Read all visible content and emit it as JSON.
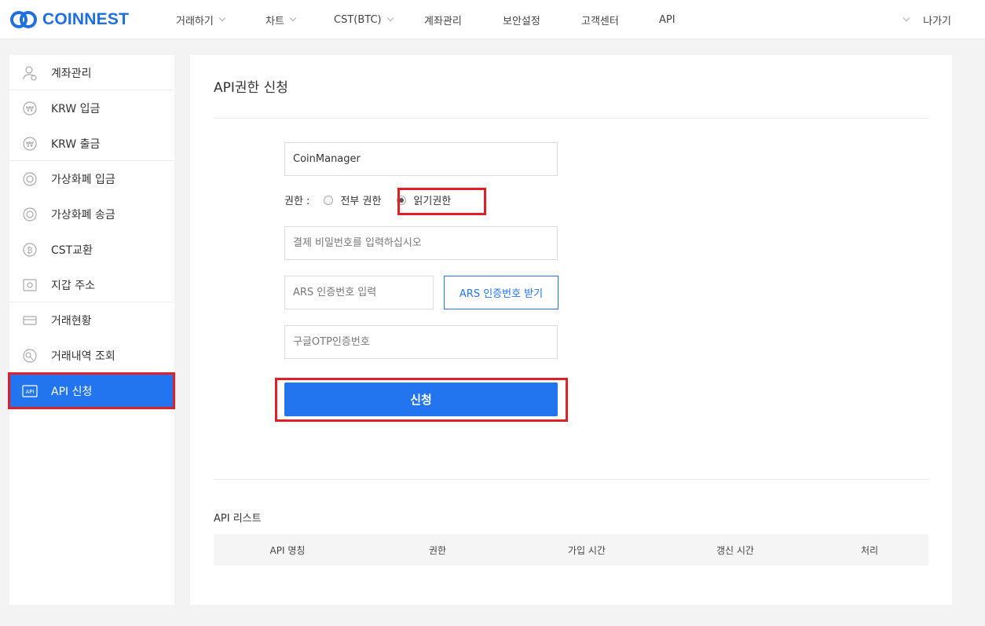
{
  "brand": {
    "name": "COINNEST",
    "color": "#1f6fe0"
  },
  "header": {
    "nav": [
      {
        "label": "거래하기",
        "dropdown": true
      },
      {
        "label": "차트",
        "dropdown": true
      },
      {
        "label": "CST(BTC)",
        "dropdown": true
      },
      {
        "label": "계좌관리",
        "dropdown": false
      },
      {
        "label": "보안설정",
        "dropdown": false
      },
      {
        "label": "고객센터",
        "dropdown": false
      },
      {
        "label": "API",
        "dropdown": false
      }
    ],
    "logout_label": "나가기"
  },
  "sidebar": {
    "items": [
      {
        "label": "계좌관리",
        "icon": "user-icon"
      },
      {
        "label": "KRW 입금",
        "icon": "won-coin-icon"
      },
      {
        "label": "KRW 출금",
        "icon": "won-coin-icon"
      },
      {
        "label": "가상화폐 입금",
        "icon": "coin-icon"
      },
      {
        "label": "가상화폐 송금",
        "icon": "coin-icon"
      },
      {
        "label": "CST교환",
        "icon": "bitcoin-icon"
      },
      {
        "label": "지갑 주소",
        "icon": "wallet-icon"
      },
      {
        "label": "거래현황",
        "icon": "money-icon"
      },
      {
        "label": "거래내역 조회",
        "icon": "history-icon"
      },
      {
        "label": "API 신청",
        "icon": "api-icon",
        "active": true
      }
    ]
  },
  "main": {
    "title": "API권한 신청",
    "form": {
      "name_value": "CoinManager",
      "permission_label": "권한 :",
      "perm_all_label": "전부 권한",
      "perm_read_label": "읽기권한",
      "selected_permission": "읽기권한",
      "password_placeholder": "결제 비밀번호를 입력하십시오",
      "ars_placeholder": "ARS 인증번호 입력",
      "ars_button": "ARS 인증번호 받기",
      "otp_placeholder": "구글OTP인증번호",
      "submit_label": "신청"
    },
    "api_list": {
      "title": "API 리스트",
      "columns": [
        "API 명칭",
        "권한",
        "가입 시간",
        "갱신 시간",
        "처리"
      ]
    }
  },
  "colors": {
    "accent": "#2275ee",
    "highlight": "#e02027"
  }
}
